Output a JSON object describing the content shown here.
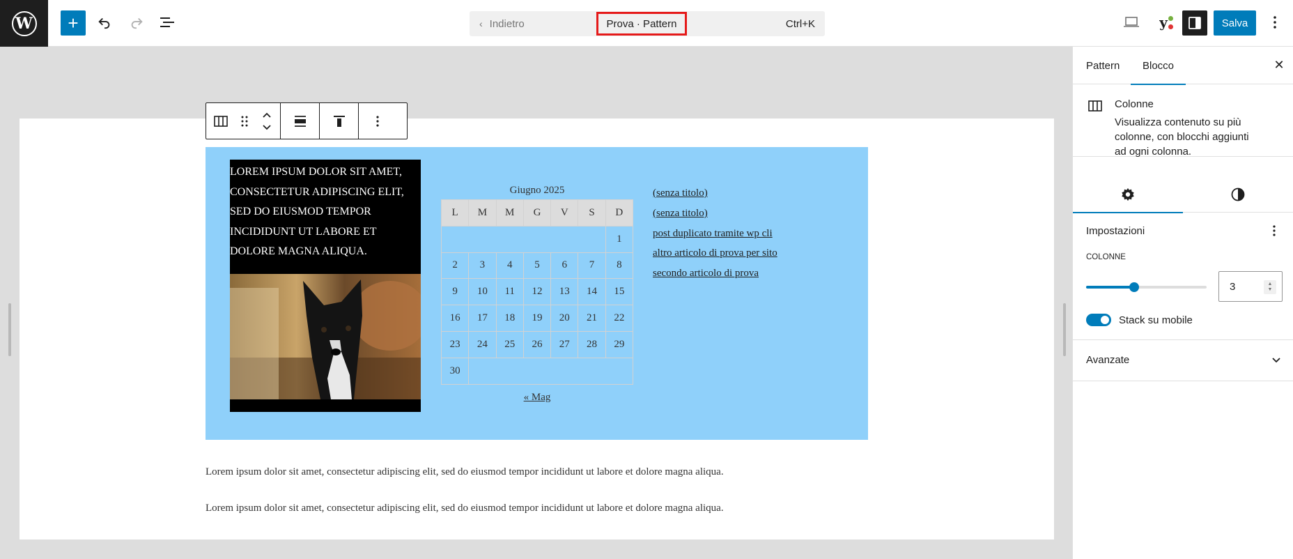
{
  "topbar": {
    "back_label": "Indietro",
    "doc_title": "Prova · Pattern",
    "shortcut": "Ctrl+K",
    "save_label": "Salva",
    "add_symbol": "+",
    "yoast_letter": "y"
  },
  "content": {
    "column1_text": "LOREM IPSUM DOLOR SIT AMET, CONSECTETUR ADIPISCING ELIT, SED DO EIUSMOD TEMPOR INCIDIDUNT UT LABORE ET DOLORE MAGNA ALIQUA.",
    "calendar": {
      "caption": "Giugno 2025",
      "weekdays": [
        "L",
        "M",
        "M",
        "G",
        "V",
        "S",
        "D"
      ],
      "weeks": [
        [
          "",
          "",
          "",
          "",
          "",
          "",
          "1"
        ],
        [
          "2",
          "3",
          "4",
          "5",
          "6",
          "7",
          "8"
        ],
        [
          "9",
          "10",
          "11",
          "12",
          "13",
          "14",
          "15"
        ],
        [
          "16",
          "17",
          "18",
          "19",
          "20",
          "21",
          "22"
        ],
        [
          "23",
          "24",
          "25",
          "26",
          "27",
          "28",
          "29"
        ],
        [
          "30",
          "",
          "",
          "",
          "",
          "",
          ""
        ]
      ],
      "prev_link": "« Mag"
    },
    "posts": [
      "(senza titolo)",
      "(senza titolo)",
      "post duplicato tramite wp cli",
      "altro articolo di prova per sito",
      "secondo articolo di prova"
    ],
    "paragraph1": "Lorem ipsum dolor sit amet, consectetur adipiscing elit, sed do eiusmod tempor incididunt ut labore et dolore magna aliqua.",
    "paragraph2": "Lorem ipsum dolor sit amet, consectetur adipiscing elit, sed do eiusmod tempor incididunt ut labore et dolore magna aliqua."
  },
  "sidebar": {
    "tab_pattern": "Pattern",
    "tab_blocco": "Blocco",
    "block_title": "Colonne",
    "block_desc": "Visualizza contenuto su più colonne, con blocchi aggiunti ad ogni colonna.",
    "settings_heading": "Impostazioni",
    "columns_label": "COLONNE",
    "columns_value": "3",
    "columns_min": 1,
    "columns_max": 6,
    "stack_label": "Stack su mobile",
    "stack_on": true,
    "advanced_label": "Avanzate"
  },
  "colors": {
    "accent": "#007cba",
    "columns_bg": "#8fd0fa",
    "highlight": "#e51a1a"
  }
}
